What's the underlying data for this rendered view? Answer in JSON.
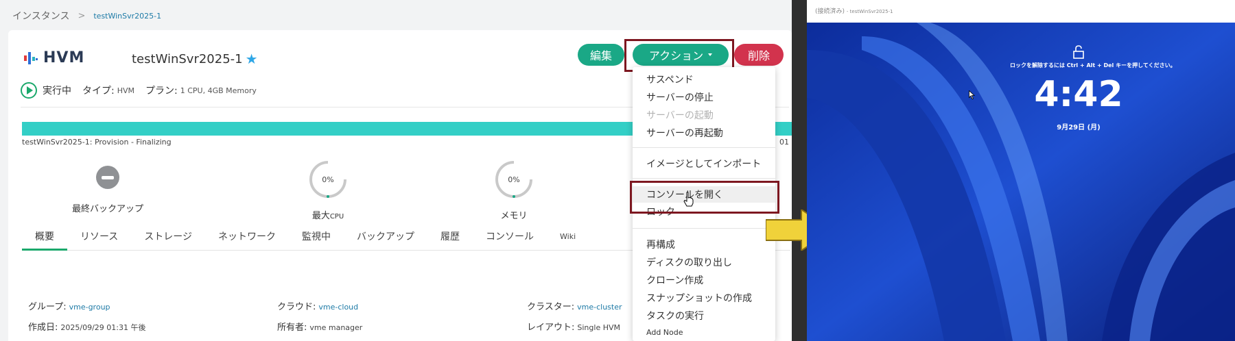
{
  "breadcrumb": {
    "root": "インスタンス",
    "current": "testWinSvr2025-1"
  },
  "instance": {
    "logo_text": "HVM",
    "name": "testWinSvr2025-1",
    "status": "実行中",
    "type_label": "タイプ:",
    "type_value": "HVM",
    "plan_label": "プラン:",
    "plan_value": "1 CPU, 4GB Memory"
  },
  "toolbar": {
    "edit_label": "編集",
    "action_label": "アクション",
    "delete_label": "削除"
  },
  "progress": {
    "label": "testWinSvr2025-1: Provision - Finalizing",
    "count": "01",
    "fraction": 1.0
  },
  "metrics": {
    "backup_label": "最終バックアップ",
    "cpu_value": "0%",
    "cpu_label": "最大",
    "cpu_unit": "CPU",
    "mem_value": "0%",
    "mem_label": "メモリ"
  },
  "tabs": [
    "概要",
    "リソース",
    "ストレージ",
    "ネットワーク",
    "監視中",
    "バックアップ",
    "履歴",
    "コンソール",
    "Wiki"
  ],
  "details": {
    "group_label": "グループ:",
    "group_value": "vme-group",
    "cloud_label": "クラウド:",
    "cloud_value": "vme-cloud",
    "cluster_label": "クラスター:",
    "cluster_value": "vme-cluster",
    "created_label": "作成日:",
    "created_value": "2025/09/29 01:31 午後",
    "owner_label": "所有者:",
    "owner_value": "vme manager",
    "layout_label": "レイアウト:",
    "layout_value": "Single HVM"
  },
  "menu": {
    "suspend": "サスペンド",
    "stop": "サーバーの停止",
    "start": "サーバーの起動",
    "restart": "サーバーの再起動",
    "import_image": "イメージとしてインポート",
    "open_console": "コンソールを開く",
    "lock": "ロック",
    "reconfigure": "再構成",
    "eject_disk": "ディスクの取り出し",
    "clone": "クローン作成",
    "snapshot": "スナップショットの作成",
    "run_task": "タスクの実行",
    "add_node": "Add Node"
  },
  "console": {
    "title": "(接続済み)",
    "title_sub": "- testWinSvr2025-1",
    "unlock_text": "ロックを解除するには Ctrl + Alt + Del キーを押してください。",
    "time": "4:42",
    "date": "9月29日 (月)"
  },
  "colors": {
    "accent": "#1aa886",
    "danger": "#d2334d",
    "highlight": "#7d1720",
    "progress": "#33cfc6"
  }
}
